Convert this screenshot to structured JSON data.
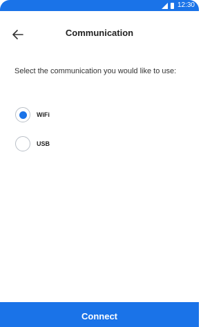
{
  "status_bar": {
    "time": "12:30",
    "icons": [
      "signal-icon",
      "battery-icon"
    ]
  },
  "header": {
    "back_icon": "arrow-left-icon",
    "title": "Communication"
  },
  "main": {
    "prompt": "Select the communication you would like to use:",
    "options": [
      {
        "label": "WiFi",
        "selected": true
      },
      {
        "label": "USB",
        "selected": false
      }
    ]
  },
  "footer": {
    "connect_label": "Connect"
  },
  "colors": {
    "accent": "#1a73e8",
    "radio_border": "#b9bfc7",
    "text": "#222222"
  }
}
